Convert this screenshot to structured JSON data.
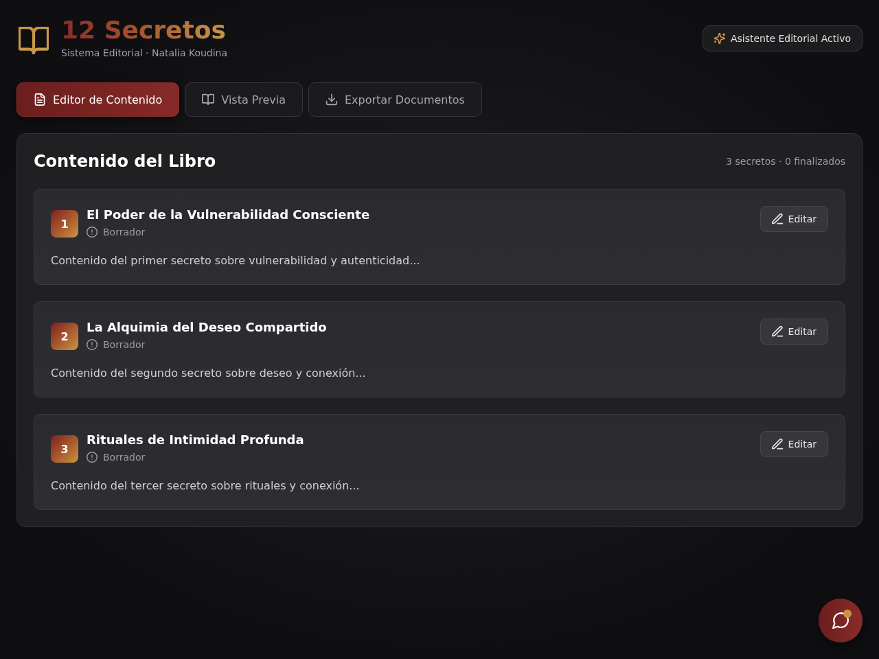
{
  "header": {
    "title": "12 Secretos",
    "subtitle": "Sistema Editorial · Natalia Koudina",
    "assistant_badge": "Asistente Editorial Activo"
  },
  "tabs": [
    {
      "label": "Editor de Contenido",
      "selected": true
    },
    {
      "label": "Vista Previa",
      "selected": false
    },
    {
      "label": "Exportar Documentos",
      "selected": false
    }
  ],
  "panel": {
    "title": "Contenido del Libro",
    "summary": "3 secretos · 0 finalizados",
    "secrets": [
      {
        "number": "1",
        "title": "El Poder de la Vulnerabilidad Consciente",
        "status": "Borrador",
        "excerpt": "Contenido del primer secreto sobre vulnerabilidad y autenticidad...",
        "action": "Editar"
      },
      {
        "number": "2",
        "title": "La Alquimia del Deseo Compartido",
        "status": "Borrador",
        "excerpt": "Contenido del segundo secreto sobre deseo y conexión...",
        "action": "Editar"
      },
      {
        "number": "3",
        "title": "Rituales de Intimidad Profunda",
        "status": "Borrador",
        "excerpt": "Contenido del tercer secreto sobre rituales y conexión...",
        "action": "Editar"
      }
    ]
  },
  "chat_button": {
    "has_notification": true
  }
}
